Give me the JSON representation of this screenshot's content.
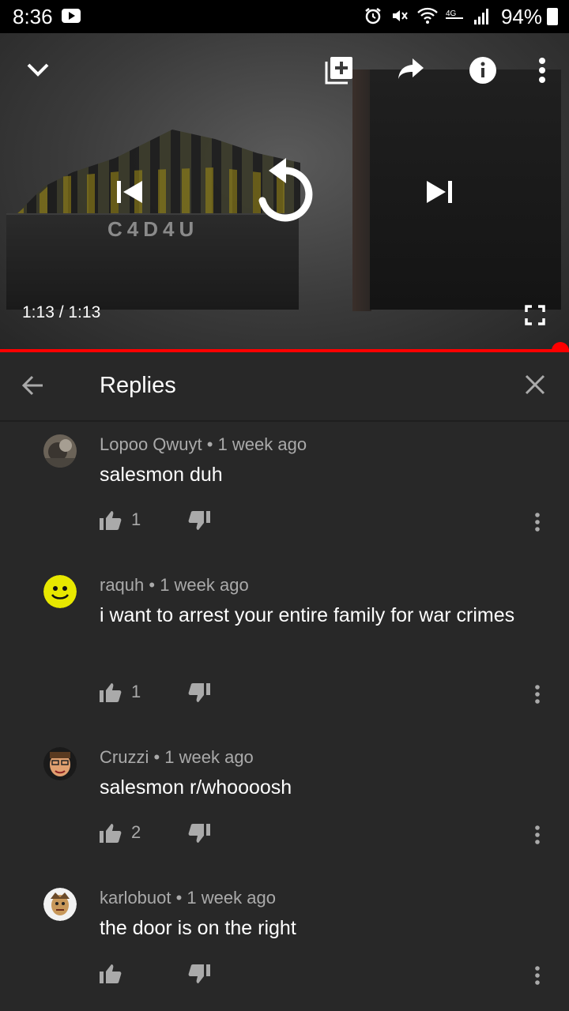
{
  "status_bar": {
    "time": "8:36",
    "battery": "94%"
  },
  "video": {
    "logo_text": "C4D4U",
    "time_display": "1:13 / 1:13",
    "progress": 1.0,
    "accent_color": "#ff0000"
  },
  "replies": {
    "title": "Replies"
  },
  "comments": [
    {
      "meta": "Lopoo Qwuyt • 1 week ago",
      "text": "salesmon duh",
      "likes": "1"
    },
    {
      "meta": "raquh • 1 week ago",
      "text": "i want to arrest your entire family for war crimes",
      "likes": "1"
    },
    {
      "meta": "Cruzzi • 1 week ago",
      "text": "salesmon r/whoooosh",
      "likes": "2"
    },
    {
      "meta": "karlobuot • 1 week ago",
      "text": "the door is on the right",
      "likes": ""
    }
  ]
}
